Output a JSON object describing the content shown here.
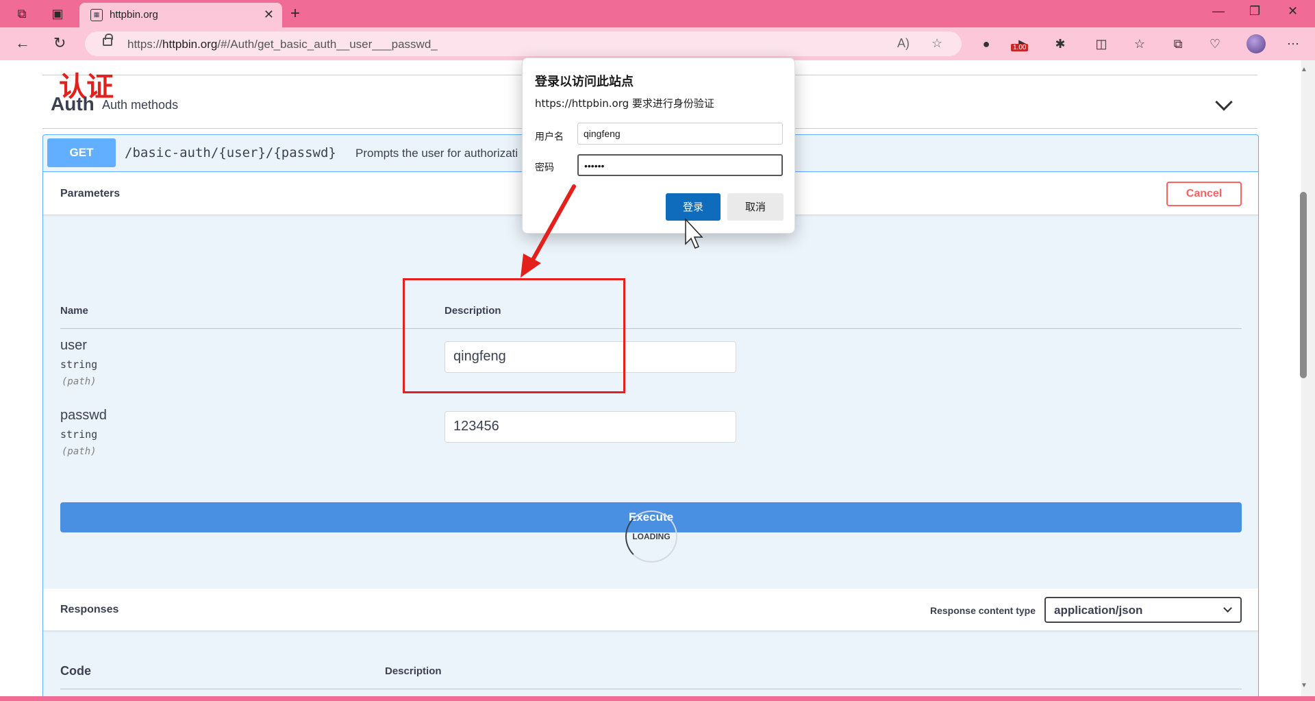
{
  "browser": {
    "tab_title": "httpbin.org",
    "url_prefix": "https://",
    "url_host": "httpbin.org",
    "url_path": "/#/Auth/get_basic_auth__user___passwd_",
    "extension_badge": "1.00",
    "theme_color": "#f06c97"
  },
  "page": {
    "annotation_title": "认证",
    "section_title": "Auth",
    "section_desc": "Auth methods",
    "operation": {
      "method": "GET",
      "path": "/basic-auth/{user}/{passwd}",
      "summary": "Prompts the user for authorizati"
    },
    "parameters": {
      "title": "Parameters",
      "cancel_label": "Cancel",
      "col_name": "Name",
      "col_description": "Description",
      "items": [
        {
          "name": "user",
          "type": "string",
          "in": "(path)",
          "value": "qingfeng"
        },
        {
          "name": "passwd",
          "type": "string",
          "in": "(path)",
          "value": "123456"
        }
      ]
    },
    "execute_label": "Execute",
    "loading_label": "LOADING",
    "responses": {
      "title": "Responses",
      "content_type_label": "Response content type",
      "content_type_value": "application/json",
      "col_code": "Code",
      "col_description": "Description"
    }
  },
  "dialog": {
    "title": "登录以访问此站点",
    "subtitle": "https://httpbin.org 要求进行身份验证",
    "username_label": "用户名",
    "username_value": "qingfeng",
    "password_label": "密码",
    "password_value": "••••••",
    "login_label": "登录",
    "cancel_label": "取消"
  },
  "colors": {
    "method_get": "#61affe",
    "execute": "#4990e2",
    "cancel": "#ff6060",
    "annotation": "#e3201b",
    "login_button": "#0f6cbd"
  }
}
